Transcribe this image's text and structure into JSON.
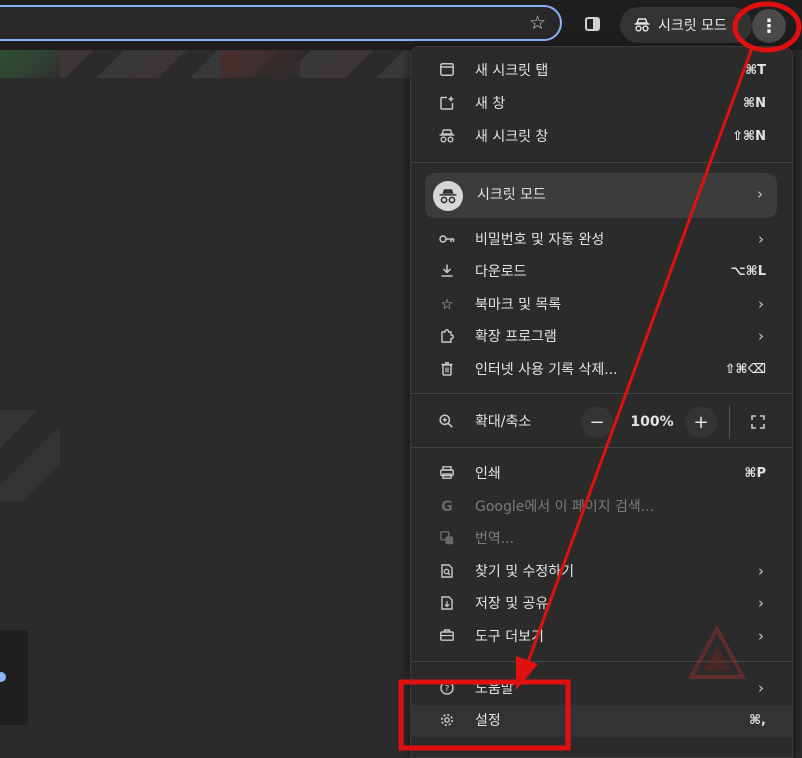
{
  "toolbar": {
    "incognito_label": "시크릿 모드",
    "icons": {
      "bookmark": "star-icon",
      "side_panel": "side-panel-icon",
      "menu": "kebab-menu-icon"
    }
  },
  "menu": {
    "new_incognito_tab": {
      "label": "새 시크릿 탭",
      "shortcut": "⌘T"
    },
    "new_window": {
      "label": "새 창",
      "shortcut": "⌘N"
    },
    "new_incognito_window": {
      "label": "새 시크릿 창",
      "shortcut": "⇧⌘N"
    },
    "profile": {
      "label": "시크릿 모드"
    },
    "passwords": {
      "label": "비밀번호 및 자동 완성"
    },
    "downloads": {
      "label": "다운로드",
      "shortcut": "⌥⌘L"
    },
    "bookmarks": {
      "label": "북마크 및 목록"
    },
    "extensions": {
      "label": "확장 프로그램"
    },
    "clear_history": {
      "label": "인터넷 사용 기록 삭제...",
      "shortcut": "⇧⌘⌫"
    },
    "zoom": {
      "label": "확대/축소",
      "minus": "−",
      "value": "100%",
      "plus": "+"
    },
    "print": {
      "label": "인쇄",
      "shortcut": "⌘P"
    },
    "search_google": {
      "label": "Google에서 이 페이지 검색..."
    },
    "translate": {
      "label": "번역..."
    },
    "find_edit": {
      "label": "찾기 및 수정하기"
    },
    "save_share": {
      "label": "저장 및 공유"
    },
    "more_tools": {
      "label": "도구 더보기"
    },
    "help": {
      "label": "도움말"
    },
    "settings": {
      "label": "설정",
      "shortcut": "⌘,"
    }
  },
  "colors": {
    "annotation": "#e01010",
    "focus_ring": "#8ab4f8",
    "menu_bg": "#2b2b2b"
  }
}
